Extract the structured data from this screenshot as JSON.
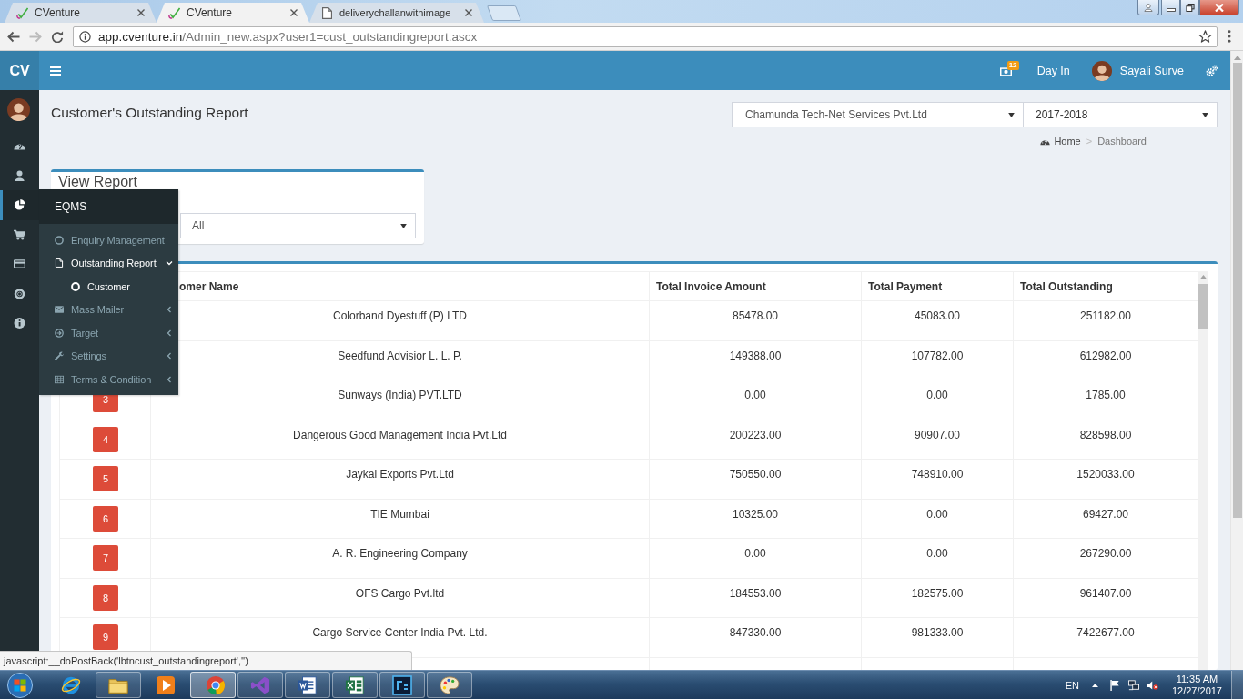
{
  "browser": {
    "tabs": [
      {
        "title": "CVenture",
        "selected": false
      },
      {
        "title": "CVenture",
        "selected": true
      },
      {
        "title": "deliverychallanwithimage",
        "selected": false
      }
    ],
    "address": {
      "host": "app.cventure.in",
      "path": "/Admin_new.aspx?user1=cust_outstandingreport.ascx"
    },
    "status_text": "javascript:__doPostBack('lbtncust_outstandingreport','')"
  },
  "header": {
    "logo": "CV",
    "notification_count": "12",
    "day_in": "Day In",
    "user_name": "Sayali Surve"
  },
  "sidebar": {
    "items": [
      {
        "selected": false
      },
      {
        "selected": false
      },
      {
        "selected": true
      },
      {
        "selected": false
      },
      {
        "selected": false
      },
      {
        "selected": false
      },
      {
        "selected": false
      }
    ]
  },
  "flyout": {
    "title": "EQMS",
    "items": [
      {
        "label": "Enquiry Management",
        "kind": "link",
        "selected": false
      },
      {
        "label": "Outstanding Report",
        "kind": "group",
        "selected": true,
        "expanded": true,
        "children": [
          {
            "label": "Customer",
            "selected": true
          }
        ]
      },
      {
        "label": "Mass Mailer",
        "kind": "group",
        "selected": false,
        "expanded": false
      },
      {
        "label": "Target",
        "kind": "group",
        "selected": false,
        "expanded": false
      },
      {
        "label": "Settings",
        "kind": "group",
        "selected": false,
        "expanded": false
      },
      {
        "label": "Terms & Condition",
        "kind": "group",
        "selected": false,
        "expanded": false
      }
    ]
  },
  "page": {
    "title": "Customer's Outstanding Report",
    "company_select": "Chamunda Tech-Net Services Pvt.Ltd",
    "year_select": "2017-2018",
    "breadcrumb": [
      {
        "label": "Home"
      },
      {
        "label": "Dashboard"
      }
    ],
    "breadcrumb_separator": ">"
  },
  "view_report": {
    "title": "View Report",
    "select": "All"
  },
  "table": {
    "columns": [
      "omer Name",
      "Total Invoice Amount",
      "Total Payment",
      "Total Outstanding"
    ],
    "rows": [
      {
        "customer": "Colorband Dyestuff (P) LTD",
        "invoice": "85478.00",
        "payment": "45083.00",
        "outstanding": "251182.00"
      },
      {
        "customer": "Seedfund Advisior L. L. P.",
        "invoice": "149388.00",
        "payment": "107782.00",
        "outstanding": "612982.00"
      },
      {
        "number": "3",
        "customer": "Sunways (India) PVT.LTD",
        "invoice": "0.00",
        "payment": "0.00",
        "outstanding": "1785.00"
      },
      {
        "number": "4",
        "customer": "Dangerous Good Management India Pvt.Ltd",
        "invoice": "200223.00",
        "payment": "90907.00",
        "outstanding": "828598.00"
      },
      {
        "number": "5",
        "customer": "Jaykal Exports Pvt.Ltd",
        "invoice": "750550.00",
        "payment": "748910.00",
        "outstanding": "1520033.00"
      },
      {
        "number": "6",
        "customer": "TIE Mumbai",
        "invoice": "10325.00",
        "payment": "0.00",
        "outstanding": "69427.00"
      },
      {
        "number": "7",
        "customer": "A. R. Engineering Company",
        "invoice": "0.00",
        "payment": "0.00",
        "outstanding": "267290.00"
      },
      {
        "number": "8",
        "customer": "OFS Cargo Pvt.ltd",
        "invoice": "184553.00",
        "payment": "182575.00",
        "outstanding": "961407.00"
      },
      {
        "number": "9",
        "customer": "Cargo Service Center India Pvt. Ltd.",
        "invoice": "847330.00",
        "payment": "981333.00",
        "outstanding": "7422677.00"
      }
    ]
  },
  "taskbar": {
    "apps": [
      {
        "running": false,
        "selected": false
      },
      {
        "running": true,
        "selected": false
      },
      {
        "running": false,
        "selected": false
      },
      {
        "running": true,
        "selected": true
      },
      {
        "running": true,
        "selected": false
      },
      {
        "running": true,
        "selected": false
      },
      {
        "running": true,
        "selected": false
      },
      {
        "running": true,
        "selected": false
      },
      {
        "running": true,
        "selected": false
      }
    ],
    "language": "EN",
    "time": "11:35 AM",
    "date": "12/27/2017"
  }
}
